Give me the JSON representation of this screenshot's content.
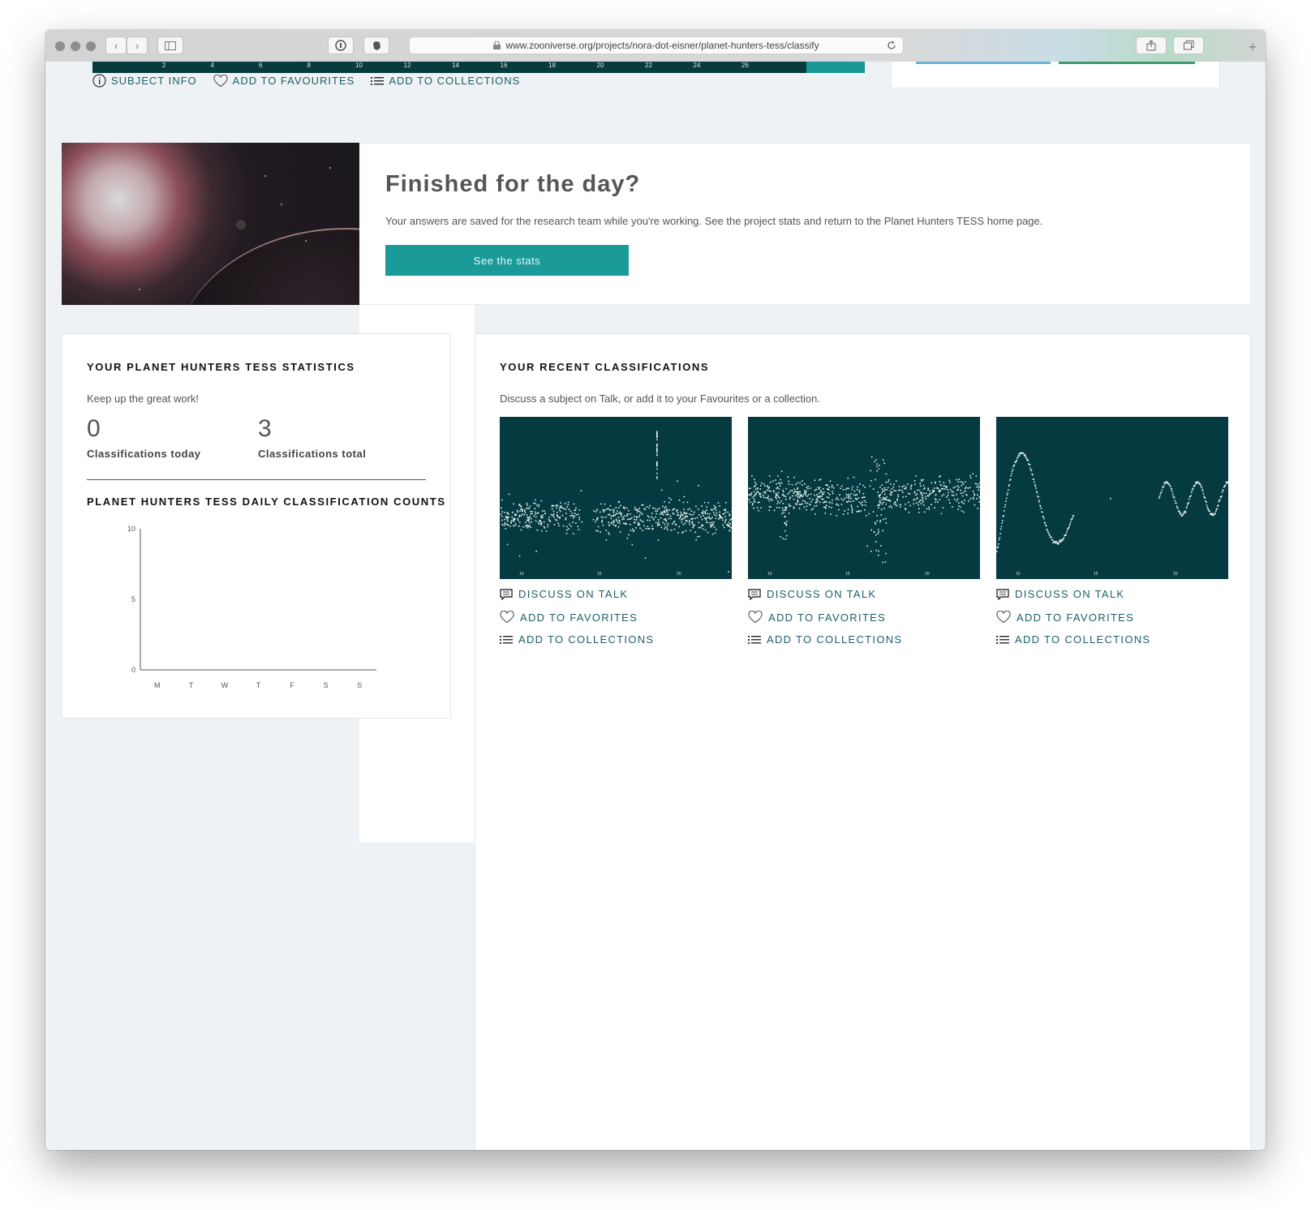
{
  "browser": {
    "url": "www.zooniverse.org/projects/nora-dot-eisner/planet-hunters-tess/classify"
  },
  "subject_strip": {
    "ticks": [
      "2",
      "4",
      "6",
      "8",
      "10",
      "12",
      "14",
      "16",
      "18",
      "20",
      "22",
      "24",
      "26"
    ]
  },
  "subject_links": {
    "info": "SUBJECT INFO",
    "favourites": "ADD TO FAVOURITES",
    "collections": "ADD TO COLLECTIONS"
  },
  "finished": {
    "title": "Finished for the day?",
    "text": "Your answers are saved for the research team while you're working. See the project stats and return to the Planet Hunters TESS home page.",
    "button": "See the stats"
  },
  "stats": {
    "heading": "YOUR PLANET HUNTERS TESS STATISTICS",
    "subtitle": "Keep up the great work!",
    "today_value": "0",
    "today_label": "Classifications today",
    "total_value": "3",
    "total_label": "Classifications total",
    "chart_heading": "PLANET HUNTERS TESS DAILY CLASSIFICATION COUNTS"
  },
  "chart_data": {
    "type": "bar",
    "title": "PLANET HUNTERS TESS DAILY CLASSIFICATION COUNTS",
    "categories": [
      "M",
      "T",
      "W",
      "T",
      "F",
      "S",
      "S"
    ],
    "values": [
      0,
      0,
      0,
      0,
      0,
      0,
      0
    ],
    "y_ticks": [
      "10",
      "5",
      "0"
    ],
    "ylim": [
      0,
      10
    ],
    "grid": false
  },
  "recent": {
    "heading": "YOUR RECENT CLASSIFICATIONS",
    "subtitle": "Discuss a subject on Talk, or add it to your Favourites or a collection.",
    "items": [
      {
        "ticks": [
          "10",
          "15",
          "20"
        ],
        "talk": "DISCUSS ON TALK",
        "fav": "ADD TO FAVORITES",
        "coll": "ADD TO COLLECTIONS"
      },
      {
        "ticks": [
          "10",
          "15",
          "20"
        ],
        "talk": "DISCUSS ON TALK",
        "fav": "ADD TO FAVORITES",
        "coll": "ADD TO COLLECTIONS"
      },
      {
        "ticks": [
          "10",
          "15",
          "20"
        ],
        "talk": "DISCUSS ON TALK",
        "fav": "ADD TO FAVORITES",
        "coll": "ADD TO COLLECTIONS"
      }
    ]
  },
  "colors": {
    "teal_button": "#1b9a9a",
    "dark_teal": "#043a40",
    "link_teal": "#1d5f66"
  },
  "icons": [
    "info-icon",
    "heart-icon",
    "list-icon",
    "speech-bubble-icon",
    "lock-icon",
    "reload-icon",
    "share-icon",
    "tabs-icon",
    "sidebar-icon",
    "shield-icon",
    "evernote-icon"
  ]
}
